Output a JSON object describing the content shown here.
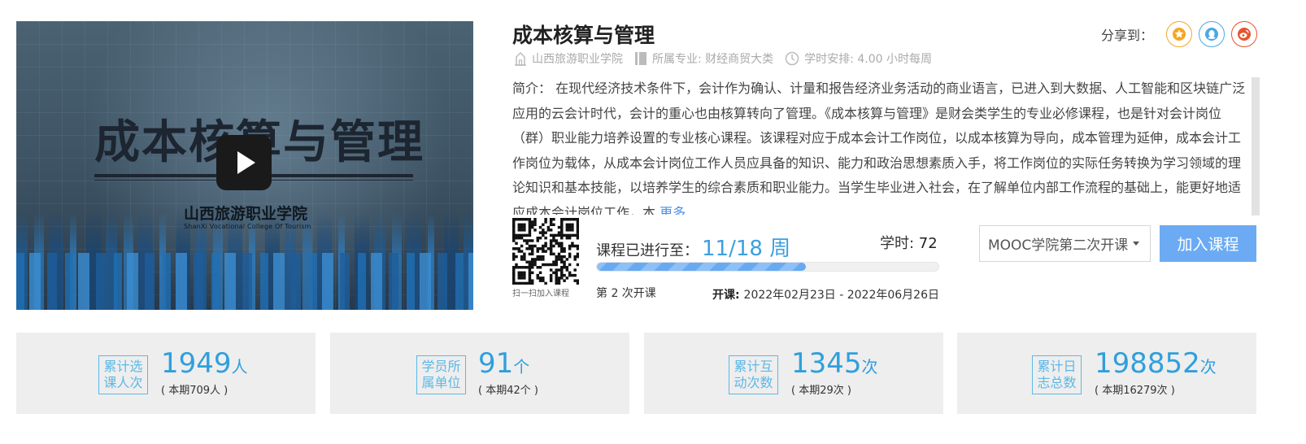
{
  "video": {
    "title": "成本核算与管理",
    "school": "山西旅游职业学院",
    "school_en": "ShanXi Vocational College Of Tourism"
  },
  "course": {
    "title": "成本核算与管理",
    "school": "山西旅游职业学院",
    "major": "所属专业: 财经商贸大类",
    "schedule": "学时安排: 4.00 小时每周"
  },
  "share": {
    "label": "分享到：",
    "icons": [
      "qzone-star-icon",
      "qq-penguin-icon",
      "weibo-icon"
    ],
    "colors": {
      "qzone": "#f5a623",
      "qq": "#4aa8e8",
      "weibo": "#e8542b"
    }
  },
  "intro": {
    "text": "简介： 在现代经济技术条件下，会计作为确认、计量和报告经济业务活动的商业语言，已进入到大数据、人工智能和区块链广泛应用的云会计时代，会计的重心也由核算转向了管理。《成本核算与管理》是财会类学生的专业必修课程，也是针对会计岗位（群）职业能力培养设置的专业核心课程。该课程对应于成本会计工作岗位，以成本核算为导向，成本管理为延伸，成本会计工作岗位为载体，从成本会计岗位工作人员应具备的知识、能力和政治思想素质入手，将工作岗位的实际任务转换为学习领域的理论知识和基本技能，以培养学生的综合素质和职业能力。当学生毕业进入社会，在了解单位内部工作流程的基础上，能更好地适应成本会计岗位工作，本",
    "more": "更多"
  },
  "qr": {
    "caption": "扫一扫加入课程"
  },
  "progress": {
    "label": "课程已进行至：",
    "value": "11/18 周",
    "current_week": 11,
    "total_weeks": 18,
    "hours_label": "学时: ",
    "hours_value": "72",
    "term": "第 2 次开课",
    "dates_label": "开课: ",
    "dates_value": "2022年02月23日 - 2022年06月26日"
  },
  "session_select": {
    "selected": "MOOC学院第二次开课"
  },
  "join_button": {
    "label": "加入课程"
  },
  "stats": [
    {
      "tag_line1": "累计选",
      "tag_line2": "课人次",
      "num": "1949",
      "unit": "人",
      "sub": "( 本期709人 )"
    },
    {
      "tag_line1": "学员所",
      "tag_line2": "属单位",
      "num": "91",
      "unit": "个",
      "sub": "( 本期42个 )"
    },
    {
      "tag_line1": "累计互",
      "tag_line2": "动次数",
      "num": "1345",
      "unit": "次",
      "sub": "( 本期29次 )"
    },
    {
      "tag_line1": "累计日",
      "tag_line2": "志总数",
      "num": "198852",
      "unit": "次",
      "sub": "( 本期16279次 )"
    }
  ]
}
